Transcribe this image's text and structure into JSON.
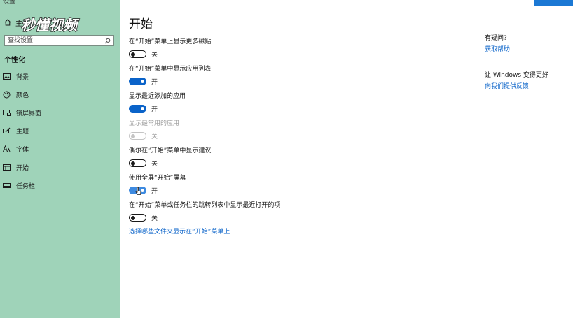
{
  "app": {
    "title": "设置"
  },
  "sidebar": {
    "home_label": "主页",
    "search_placeholder": "查找设置",
    "section_title": "个性化",
    "items": [
      {
        "label": "背景",
        "icon": "image-icon"
      },
      {
        "label": "颜色",
        "icon": "palette-icon"
      },
      {
        "label": "锁屏界面",
        "icon": "lock-screen-icon"
      },
      {
        "label": "主题",
        "icon": "brush-icon"
      },
      {
        "label": "字体",
        "icon": "font-icon"
      },
      {
        "label": "开始",
        "icon": "start-icon"
      },
      {
        "label": "任务栏",
        "icon": "taskbar-icon"
      }
    ]
  },
  "watermark": {
    "text": "秒懂视频"
  },
  "main": {
    "title": "开始",
    "settings": [
      {
        "label": "在“开始”菜单上显示更多磁贴",
        "state": "关",
        "on": false,
        "disabled": false
      },
      {
        "label": "在“开始”菜单中显示应用列表",
        "state": "开",
        "on": true,
        "disabled": false
      },
      {
        "label": "显示最近添加的应用",
        "state": "开",
        "on": true,
        "disabled": false
      },
      {
        "label": "显示最常用的应用",
        "state": "关",
        "on": false,
        "disabled": true
      },
      {
        "label": "偶尔在“开始”菜单中显示建议",
        "state": "关",
        "on": false,
        "disabled": false
      },
      {
        "label": "使用全屏“开始”屏幕",
        "state": "开",
        "on": true,
        "disabled": false
      },
      {
        "label": "在“开始”菜单或任务栏的跳转列表中显示最近打开的项",
        "state": "关",
        "on": false,
        "disabled": false
      }
    ],
    "folder_link": "选择哪些文件夹显示在“开始”菜单上"
  },
  "right": {
    "help_heading": "有疑问?",
    "help_link": "获取帮助",
    "feedback_heading": "让 Windows 变得更好",
    "feedback_link": "向我们提供反馈"
  },
  "colors": {
    "sidebar_bg": "#9fd3b9",
    "accent": "#0a63c9",
    "disabled": "#a0a0a0"
  }
}
